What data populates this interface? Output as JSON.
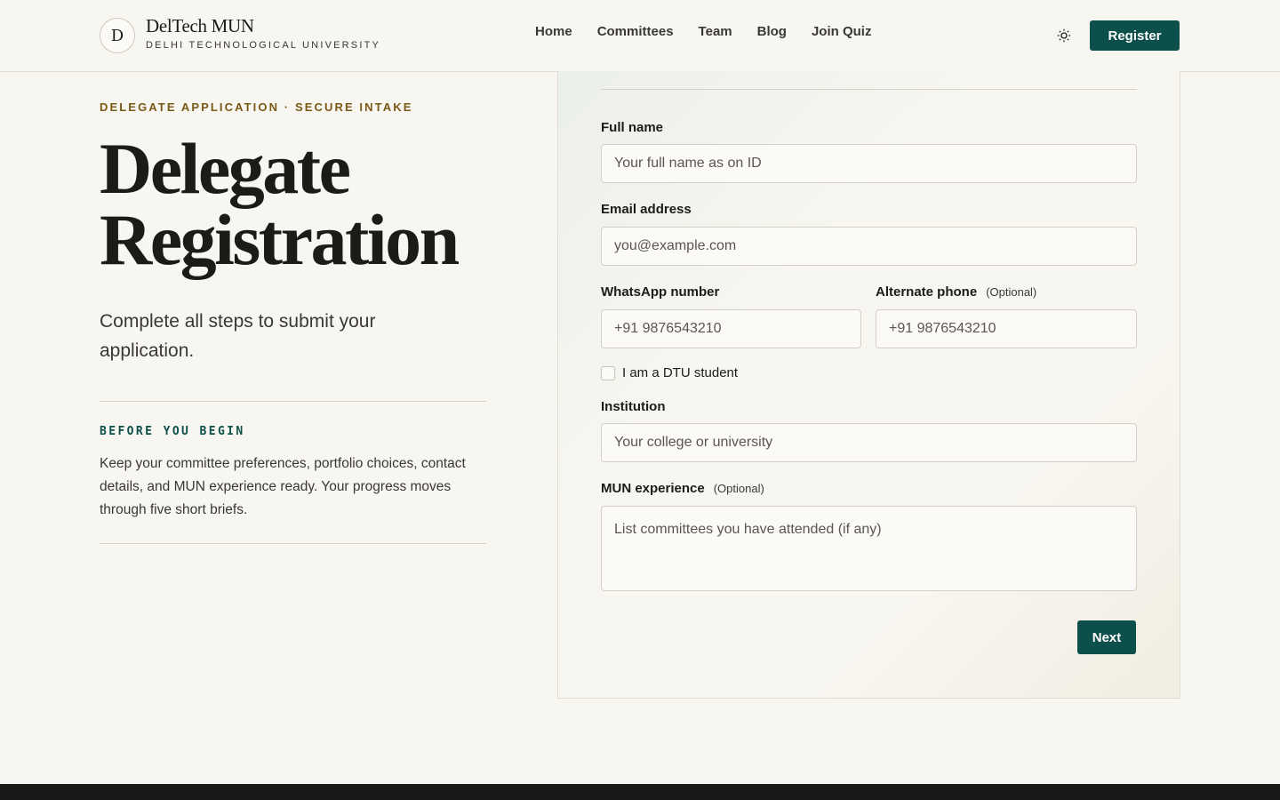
{
  "header": {
    "logo_letter": "D",
    "brand_title": "DelTech MUN",
    "brand_subtitle": "DELHI TECHNOLOGICAL UNIVERSITY",
    "nav": [
      "Home",
      "Committees",
      "Team",
      "Blog",
      "Join Quiz"
    ],
    "theme_icon": "sun-icon",
    "register_label": "Register"
  },
  "intro": {
    "eyebrow": "DELEGATE APPLICATION · SECURE INTAKE",
    "title_line1": "Delegate",
    "title_line2": "Registration",
    "subtitle": "Complete all steps to submit your application.",
    "before_label": "BEFORE YOU BEGIN",
    "before_text": "Keep your committee preferences, portfolio choices, contact details, and MUN experience ready. Your progress moves through five short briefs."
  },
  "form": {
    "full_name": {
      "label": "Full name",
      "placeholder": "Your full name as on ID"
    },
    "email": {
      "label": "Email address",
      "placeholder": "you@example.com"
    },
    "whatsapp": {
      "label": "WhatsApp number",
      "placeholder": "+91 9876543210"
    },
    "alt_phone": {
      "label": "Alternate phone",
      "optional": "(Optional)",
      "placeholder": "+91 9876543210"
    },
    "dtu_student": {
      "label": "I am a DTU student"
    },
    "institution": {
      "label": "Institution",
      "placeholder": "Your college or university"
    },
    "mun_experience": {
      "label": "MUN experience",
      "optional": "(Optional)",
      "placeholder": "List committees you have attended (if any)"
    },
    "next_label": "Next"
  },
  "colors": {
    "accent": "#0d4f4a",
    "eyebrow": "#7a5a16",
    "background": "#f8f6f1"
  }
}
